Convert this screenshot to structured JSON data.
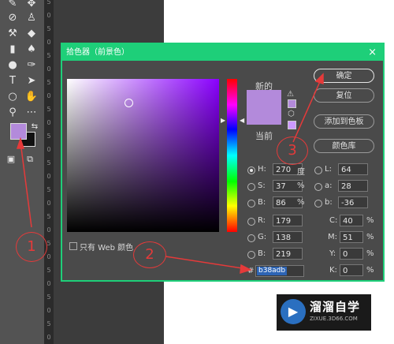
{
  "dialog": {
    "title": "拾色器（前景色）",
    "close": "×",
    "label_new": "新的",
    "label_current": "当前",
    "only_web_colors": "只有 Web 颜色",
    "current_color": "#b38adb"
  },
  "buttons": {
    "ok": "确定",
    "reset": "复位",
    "add_swatch": "添加到色板",
    "color_library": "颜色库"
  },
  "hsb": {
    "h": {
      "label": "H:",
      "value": "270",
      "unit": "度"
    },
    "s": {
      "label": "S:",
      "value": "37",
      "unit": "%"
    },
    "b": {
      "label": "B:",
      "value": "86",
      "unit": "%"
    }
  },
  "rgb": {
    "r": {
      "label": "R:",
      "value": "179"
    },
    "g": {
      "label": "G:",
      "value": "138"
    },
    "b": {
      "label": "B:",
      "value": "219"
    }
  },
  "lab": {
    "l": {
      "label": "L:",
      "value": "64"
    },
    "a": {
      "label": "a:",
      "value": "28"
    },
    "b": {
      "label": "b:",
      "value": "-36"
    }
  },
  "cmyk": {
    "c": {
      "label": "C:",
      "value": "40",
      "unit": "%"
    },
    "m": {
      "label": "M:",
      "value": "51",
      "unit": "%"
    },
    "y": {
      "label": "Y:",
      "value": "0",
      "unit": "%"
    },
    "k": {
      "label": "K:",
      "value": "0",
      "unit": "%"
    }
  },
  "hex": {
    "label": "#",
    "value": "b38adb"
  },
  "annotations": [
    "1",
    "2",
    "3"
  ],
  "ruler_ticks": [
    "5",
    "0",
    "5",
    "0",
    "5",
    "0",
    "5",
    "0",
    "5",
    "0",
    "5",
    "0",
    "5",
    "0",
    "5",
    "0",
    "5",
    "0",
    "5",
    "0",
    "5",
    "0",
    "5",
    "0",
    "5",
    "0"
  ],
  "watermark": {
    "name": "溜溜自学",
    "url": "ZIXUE.3D66.COM"
  },
  "colors": {
    "accent": "#1ecf79",
    "annotation": "#e53a3a",
    "foreground": "#b38adb"
  }
}
